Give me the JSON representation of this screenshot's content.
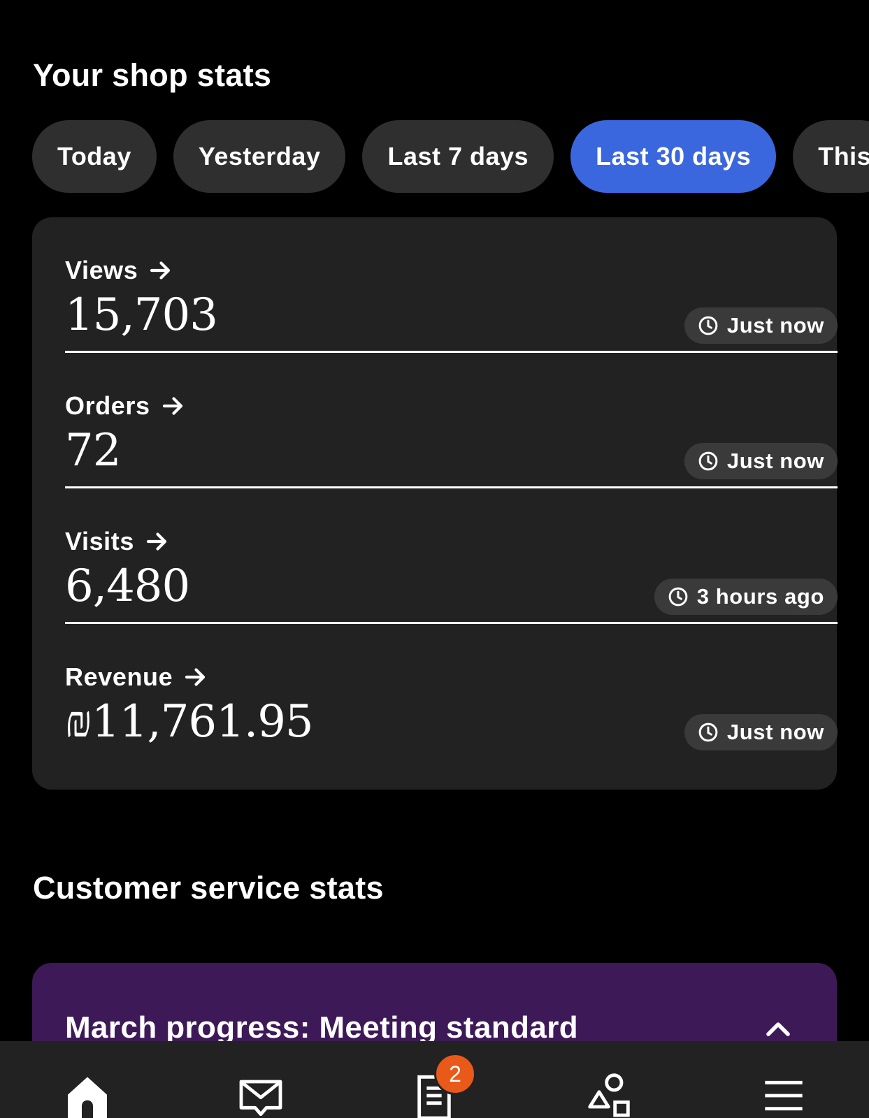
{
  "shop_stats": {
    "title": "Your shop stats",
    "filters": [
      {
        "label": "Today",
        "active": false
      },
      {
        "label": "Yesterday",
        "active": false
      },
      {
        "label": "Last 7 days",
        "active": false
      },
      {
        "label": "Last 30 days",
        "active": true
      },
      {
        "label": "This",
        "active": false
      }
    ],
    "rows": [
      {
        "label": "Views",
        "value": "15,703",
        "updated": "Just now"
      },
      {
        "label": "Orders",
        "value": "72",
        "updated": "Just now"
      },
      {
        "label": "Visits",
        "value": "6,480",
        "updated": "3 hours ago"
      },
      {
        "label": "Revenue",
        "value": "₪11,761.95",
        "updated": "Just now"
      }
    ]
  },
  "customer_service": {
    "title": "Customer service stats",
    "progress_title": "March progress: Meeting standard"
  },
  "bottom_nav": {
    "items": [
      "home-icon",
      "messages-icon",
      "orders-icon",
      "listings-icon",
      "menu-icon"
    ],
    "orders_badge": "2"
  },
  "colors": {
    "accent": "#3b67de",
    "card": "#222222",
    "progress_card": "#3d1a57",
    "badge": "#e8591a"
  }
}
